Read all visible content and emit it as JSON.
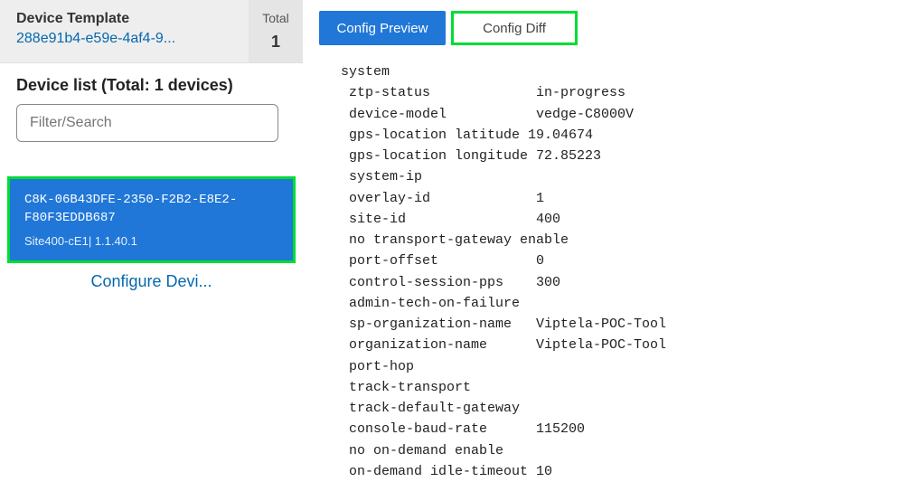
{
  "sidebar": {
    "template_label": "Device Template",
    "template_id": "288e91b4-e59e-4af4-9...",
    "total_label": "Total",
    "total_value": "1",
    "device_list_title": "Device list (Total: 1 devices)",
    "search_placeholder": "Filter/Search",
    "device_card": {
      "id": "C8K-06B43DFE-2350-F2B2-E8E2-F80F3EDDB687",
      "site": "Site400-cE1| 1.1.40.1"
    },
    "configure_link": "Configure Devi..."
  },
  "tabs": {
    "preview": "Config Preview",
    "diff": "Config Diff"
  },
  "config_text": "system\n ztp-status             in-progress\n device-model           vedge-C8000V\n gps-location latitude 19.04674\n gps-location longitude 72.85223\n system-ip\n overlay-id             1\n site-id                400\n no transport-gateway enable\n port-offset            0\n control-session-pps    300\n admin-tech-on-failure\n sp-organization-name   Viptela-POC-Tool\n organization-name      Viptela-POC-Tool\n port-hop\n track-transport\n track-default-gateway\n console-baud-rate      115200\n no on-demand enable\n on-demand idle-timeout 10"
}
